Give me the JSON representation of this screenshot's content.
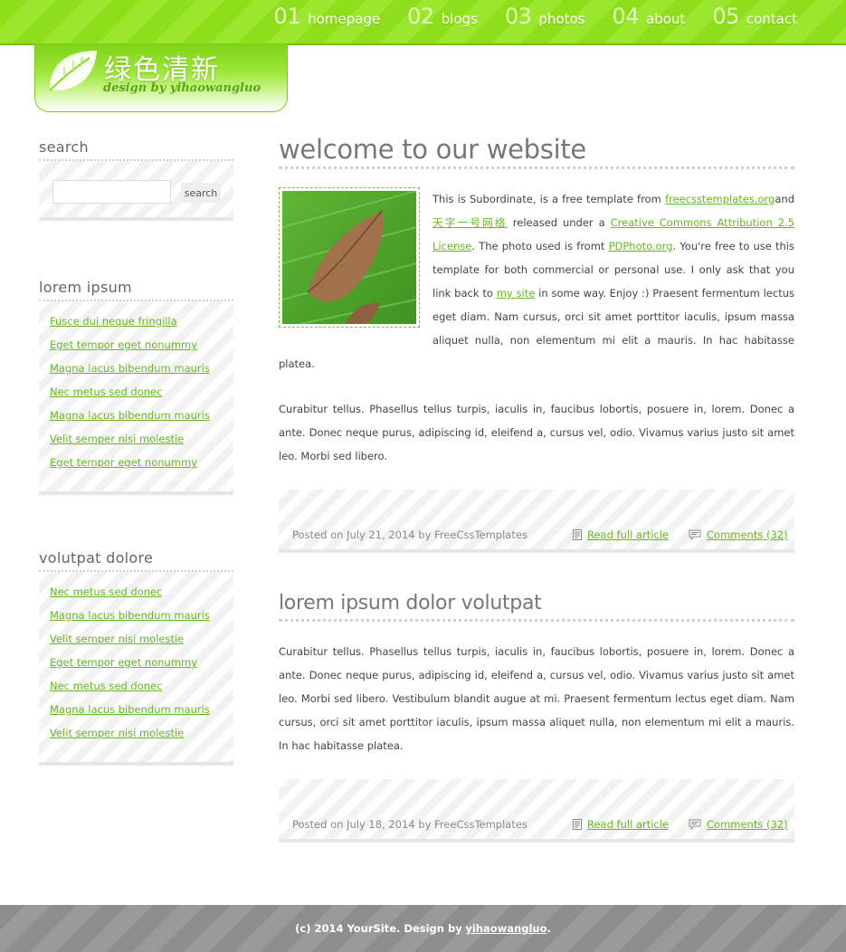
{
  "nav": [
    {
      "num": "01",
      "label": "homepage"
    },
    {
      "num": "02",
      "label": "blogs"
    },
    {
      "num": "03",
      "label": "photos"
    },
    {
      "num": "04",
      "label": "about"
    },
    {
      "num": "05",
      "label": "contact"
    }
  ],
  "logo": {
    "title": "绿色清新",
    "subtitle": "design by yihaowangluo",
    "icon": "leaf-icon"
  },
  "sidebar": {
    "search": {
      "title": "search",
      "input_value": "",
      "button_label": "search"
    },
    "box1": {
      "title": "lorem ipsum",
      "links": [
        "Fusce dui neque fringilla",
        "Eget tempor eget nonummy",
        "Magna lacus bibendum mauris",
        "Nec metus sed donec",
        "Magna lacus bibendum mauris",
        "Velit semper nisi molestie",
        "Eget tempor eget nonummy"
      ]
    },
    "box2": {
      "title": "volutpat dolore",
      "links": [
        "Nec metus sed donec",
        "Magna lacus bibendum mauris",
        "Velit semper nisi molestie",
        "Eget tempor eget nonummy",
        "Nec metus sed donec",
        "Magna lacus bibendum mauris",
        "Velit semper nisi molestie"
      ]
    }
  },
  "posts": [
    {
      "title": "welcome to our website",
      "image_icon": "leaf-photo",
      "p1": {
        "t1": "This is Subordinate, is a free template from ",
        "l1": "freecsstemplates.org",
        "t2": "and",
        "l2": "天字一号网络",
        "t3": " released under a ",
        "l3": "Creative Commons Attribution 2.5 License",
        "t4": ". The photo used is fromt ",
        "l4": "PDPhoto.org",
        "t5": ". You're free to use this template for both commercial or personal use. I only ask that you link back to ",
        "l5": "my site",
        "t6": " in some way. Enjoy :) Praesent fermentum lectus eget diam. Nam cursus, orci sit amet porttitor iaculis, ipsum massa aliquet nulla, non elementum mi elit a mauris. In hac habitasse platea."
      },
      "p2": "Curabitur tellus. Phasellus tellus turpis, iaculis in, faucibus lobortis, posuere in, lorem. Donec a ante. Donec neque purus, adipiscing id, eleifend a, cursus vel, odio. Vivamus varius justo sit amet leo. Morbi sed libero.",
      "posted": "Posted on July 21, 2014 by FreeCssTemplates",
      "read_more": "Read full article",
      "comments": "Comments (32)"
    },
    {
      "title": "lorem ipsum dolor volutpat",
      "p1": "Curabitur tellus. Phasellus tellus turpis, iaculis in, faucibus lobortis, posuere in, lorem. Donec a ante. Donec neque purus, adipiscing id, eleifend a, cursus vel, odio. Vivamus varius justo sit amet leo. Morbi sed libero. Vestibulum blandit augue at mi. Praesent fermentum lectus eget diam. Nam cursus, orci sit amet porttitor iaculis, ipsum massa aliquet nulla, non elementum mi elit a mauris. In hac habitasse platea.",
      "posted": "Posted on July 18, 2014 by FreeCssTemplates",
      "read_more": "Read full article",
      "comments": "Comments (32)"
    }
  ],
  "footer": {
    "text": "(c) 2014 YourSite. Design by ",
    "link": "yihaowangluo",
    "end": "."
  },
  "colors": {
    "accent_green": "#8fde1c",
    "link_green": "#66b81f",
    "footer_gray": "#8d8d8d"
  }
}
